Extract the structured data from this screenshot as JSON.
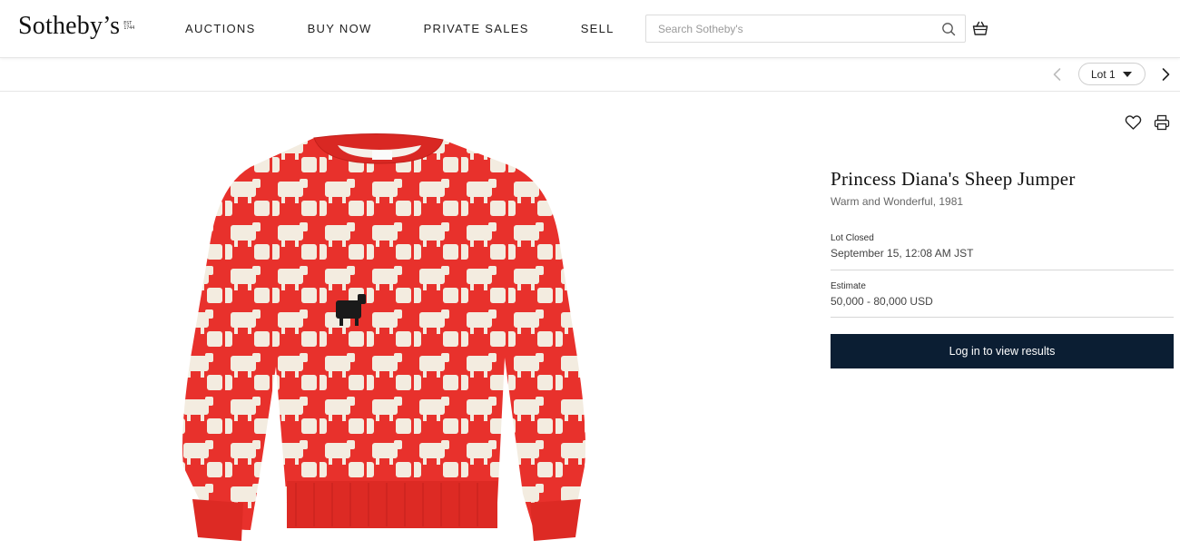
{
  "header": {
    "logo_text": "Sotheby’s",
    "logo_est": [
      "EST",
      "1744"
    ],
    "nav": [
      {
        "label": "AUCTIONS"
      },
      {
        "label": "BUY NOW"
      },
      {
        "label": "PRIVATE SALES"
      },
      {
        "label": "SELL"
      }
    ],
    "search_placeholder": "Search Sotheby's"
  },
  "lot_nav": {
    "selected_lot": "Lot 1"
  },
  "lot": {
    "title": "Princess Diana's Sheep Jumper",
    "subtitle": "Warm and Wonderful, 1981",
    "status_label": "Lot Closed",
    "status_value": "September 15, 12:08 AM JST",
    "estimate_label": "Estimate",
    "estimate_value": "50,000 - 80,000 USD",
    "login_button": "Log in to view results"
  },
  "colors": {
    "sweater_red": "#e8312c",
    "sheep_cream": "#f3ece0",
    "black_sheep": "#1a1a1a",
    "button_navy": "#0b1e33"
  }
}
